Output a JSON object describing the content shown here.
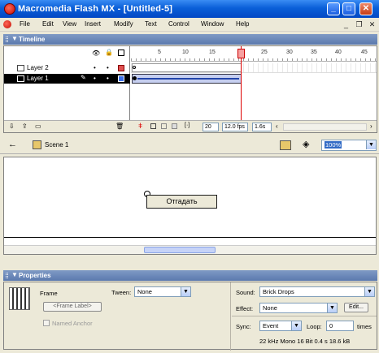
{
  "window": {
    "title": "Macromedia Flash MX - [Untitled-5]"
  },
  "menu": [
    "File",
    "Edit",
    "View",
    "Insert",
    "Modify",
    "Text",
    "Control",
    "Window",
    "Help"
  ],
  "timeline": {
    "header": "Timeline",
    "layers": [
      {
        "name": "Layer 2",
        "selected": false,
        "color": "#e05050"
      },
      {
        "name": "Layer 1",
        "selected": true,
        "color": "#3a6ee8"
      }
    ],
    "ruler_labels": [
      "5",
      "10",
      "15",
      "20",
      "25",
      "30",
      "35",
      "40",
      "45"
    ],
    "current_frame": "20",
    "frame_rate": "12.0 fps",
    "elapsed_time": "1.6s"
  },
  "editbar": {
    "scene": "Scene 1",
    "zoom": "100%"
  },
  "stage": {
    "button_label": "Отгадать"
  },
  "properties": {
    "header": "Properties",
    "frame_label": "Frame",
    "frame_label_button": "<Frame Label>",
    "named_anchor": "Named Anchor",
    "tween_label": "Tween:",
    "tween_value": "None",
    "sound_label": "Sound:",
    "sound_value": "Brick Drops",
    "effect_label": "Effect:",
    "effect_value": "None",
    "edit_button": "Edit...",
    "sync_label": "Sync:",
    "sync_value": "Event",
    "loop_label": "Loop:",
    "loop_value": "0",
    "times_label": "times",
    "sound_info": "22 kHz Mono 16 Bit 0.4 s 18.6 kB"
  }
}
